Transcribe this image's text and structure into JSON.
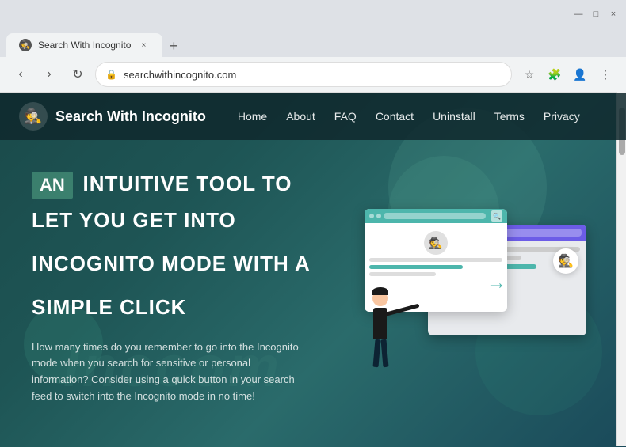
{
  "browser": {
    "tab_title": "Search With Incognito",
    "new_tab_symbol": "+",
    "close_symbol": "×",
    "back_symbol": "‹",
    "forward_symbol": "›",
    "refresh_symbol": "↻",
    "address": "searchwithincognito.com",
    "bookmark_symbol": "☆",
    "extensions_symbol": "🧩",
    "profile_symbol": "👤",
    "menu_symbol": "⋮",
    "minimize_symbol": "—",
    "maximize_symbol": "□",
    "window_close_symbol": "×"
  },
  "website": {
    "brand_name": "Search With Incognito",
    "brand_icon": "🕵",
    "nav": {
      "home": "Home",
      "about": "About",
      "faq": "FAQ",
      "contact": "Contact",
      "uninstall": "Uninstall",
      "terms": "Terms",
      "privacy": "Privacy"
    },
    "hero": {
      "tag": "AN",
      "title_line1": "INTUITIVE TOOL TO",
      "title_line2": "LET YOU GET INTO",
      "title_line3": "INCOGNITO MODE WITH A",
      "title_line4": "SIMPLE CLICK",
      "description": "How many times do you remember to go into the Incognito mode when you search for sensitive or personal information? Consider using a quick button in your search feed to switch into the Incognito mode in no time!"
    },
    "watermark": "Inccom"
  }
}
